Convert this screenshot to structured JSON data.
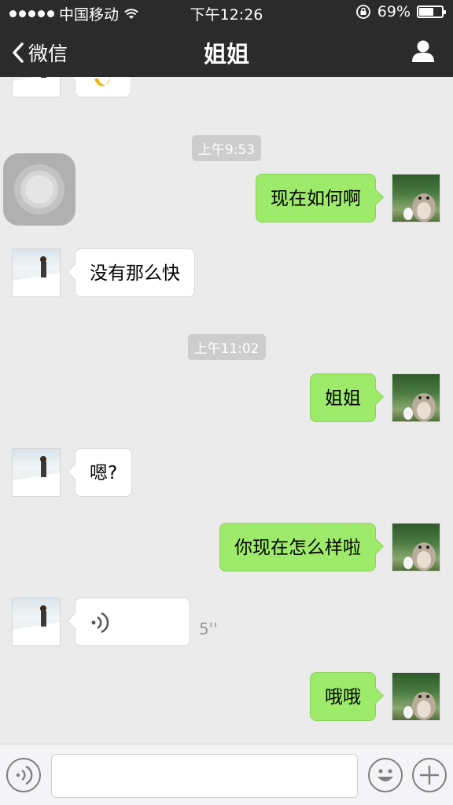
{
  "status_bar": {
    "carrier": "中国移动",
    "time": "下午12:26",
    "battery_percent": "69%",
    "battery_level": 0.69,
    "signal_icon": "signal-dots-icon",
    "wifi_icon": "wifi-icon",
    "rotation_lock_icon": "rotation-lock-icon"
  },
  "nav": {
    "back_label": "微信",
    "title": "姐姐",
    "profile_icon": "person-icon"
  },
  "chat": {
    "timestamps": [
      "上午9:53",
      "上午11:02"
    ],
    "messages": [
      {
        "sender": "friend",
        "type": "sticker",
        "text": ""
      },
      {
        "sender": "me",
        "type": "text",
        "text": "现在如何啊"
      },
      {
        "sender": "friend",
        "type": "text",
        "text": "没有那么快"
      },
      {
        "sender": "me",
        "type": "text",
        "text": "姐姐"
      },
      {
        "sender": "friend",
        "type": "text",
        "text": "嗯?"
      },
      {
        "sender": "me",
        "type": "text",
        "text": "你现在怎么样啦"
      },
      {
        "sender": "friend",
        "type": "voice",
        "text": "",
        "duration": "5''"
      },
      {
        "sender": "me",
        "type": "text",
        "text": "哦哦"
      }
    ]
  },
  "input_bar": {
    "voice_icon": "voice-toggle-icon",
    "text_value": "",
    "emoji_icon": "emoji-icon",
    "plus_icon": "plus-icon"
  },
  "colors": {
    "bar_bg": "#2b2b2b",
    "chat_bg": "#ebebeb",
    "my_bubble": "#9eea6a",
    "friend_bubble": "#ffffff"
  }
}
